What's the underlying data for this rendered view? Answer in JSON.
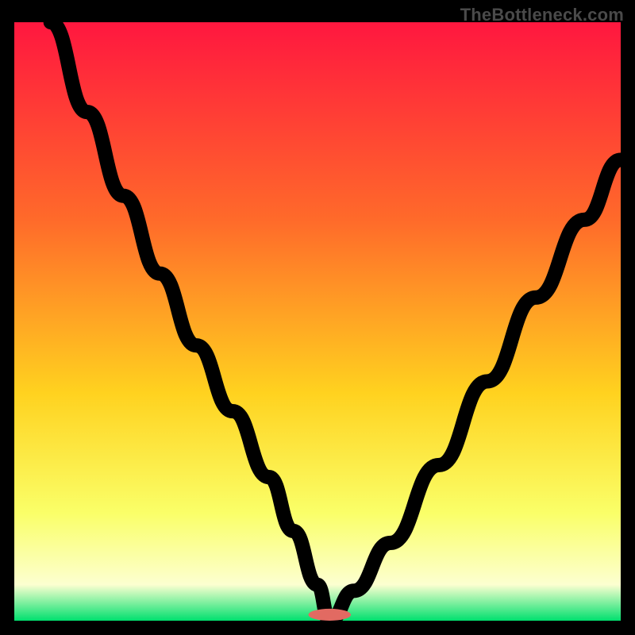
{
  "watermark": "TheBottleneck.com",
  "colors": {
    "gradient_top": "#ff173f",
    "gradient_mid1": "#ff6a2a",
    "gradient_mid2": "#ffd21f",
    "gradient_mid3": "#faff68",
    "gradient_mid4": "#fcffd0",
    "gradient_bottom": "#00e06e",
    "background": "#000000",
    "curve": "#000000",
    "marker": "#e26a62",
    "watermark": "#4a4a4a"
  },
  "chart_data": {
    "type": "line",
    "title": "",
    "xlabel": "",
    "ylabel": "",
    "xlim": [
      0,
      100
    ],
    "ylim": [
      0,
      100
    ],
    "note": "No numeric axes or ticks are visible; x/y normalized 0–100. Two monotone curves meeting near x≈52 at y≈0 form a V shape over a vertical red→green gradient. A small rounded salmon marker sits at the valley floor.",
    "series": [
      {
        "name": "left-curve",
        "x": [
          6,
          12,
          18,
          24,
          30,
          36,
          42,
          46,
          50,
          52
        ],
        "y": [
          100,
          85,
          71,
          58,
          46,
          35,
          24,
          15,
          6,
          0
        ]
      },
      {
        "name": "right-curve",
        "x": [
          52,
          56,
          62,
          70,
          78,
          86,
          94,
          100
        ],
        "y": [
          0,
          5,
          13,
          26,
          40,
          54,
          67,
          77
        ]
      }
    ],
    "marker": {
      "x": 52,
      "y": 0,
      "w": 7,
      "h": 2
    }
  }
}
